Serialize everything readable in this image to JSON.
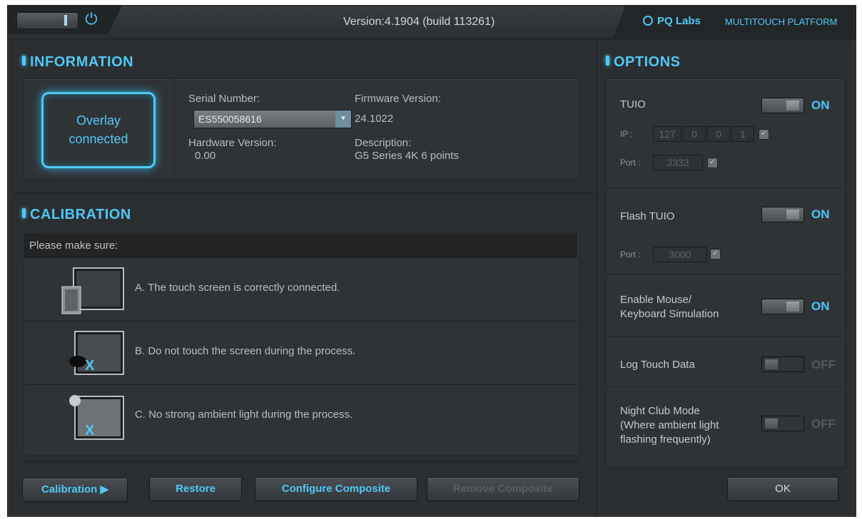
{
  "topbar": {
    "version": "Version:4.1904 (build 113261)",
    "brand": "PQ Labs",
    "brand_sub": "MULTITOUCH PLATFORM",
    "power_icon": "⏻"
  },
  "information": {
    "heading": "INFORMATION",
    "overlay_status_line1": "Overlay",
    "overlay_status_line2": "connected",
    "serial_label": "Serial Number:",
    "serial_value": "ES550058616",
    "firmware_label": "Firmware Version:",
    "firmware_value": "24.1022",
    "hardware_label": "Hardware Version:",
    "hardware_value": "0.00",
    "description_label": "Description:",
    "description_value": "G5 Series 4K 6 points"
  },
  "calibration": {
    "heading": "CALIBRATION",
    "intro": "Please make sure:",
    "items": [
      {
        "text": "A.  The touch screen is correctly connected.",
        "icon": "monitor-connected-icon"
      },
      {
        "text": "B.  Do not touch the screen during the process.",
        "icon": "no-touch-screen-icon"
      },
      {
        "text": "C.  No strong ambient light during the process.",
        "icon": "no-ambient-light-icon"
      }
    ]
  },
  "buttons": {
    "calibration": "Calibration",
    "restore": "Restore",
    "configure_composite": "Configure Composite",
    "remove_composite": "Remove Composite",
    "ok": "OK"
  },
  "options": {
    "heading": "OPTIONS",
    "tuio": {
      "label": "TUIO",
      "state": "ON",
      "ip_label": "IP :",
      "ip": [
        "127",
        "0",
        "0",
        "1"
      ],
      "port_label": "Port :",
      "port": "3333"
    },
    "flash_tuio": {
      "label": "Flash TUIO",
      "state": "ON",
      "port_label": "Port :",
      "port": "3000"
    },
    "mouse_sim": {
      "label_line1": "Enable Mouse/",
      "label_line2": "Keyboard Simulation",
      "state": "ON"
    },
    "log_touch": {
      "label": "Log Touch Data",
      "state": "OFF"
    },
    "night_club": {
      "label_line1": "Night Club Mode",
      "label_line2": "(Where ambient light",
      "label_line3": "flashing frequently)",
      "state": "OFF"
    }
  },
  "colors": {
    "accent": "#4fc8f3",
    "background": "#2b2e31",
    "text": "#b8bcbf"
  }
}
